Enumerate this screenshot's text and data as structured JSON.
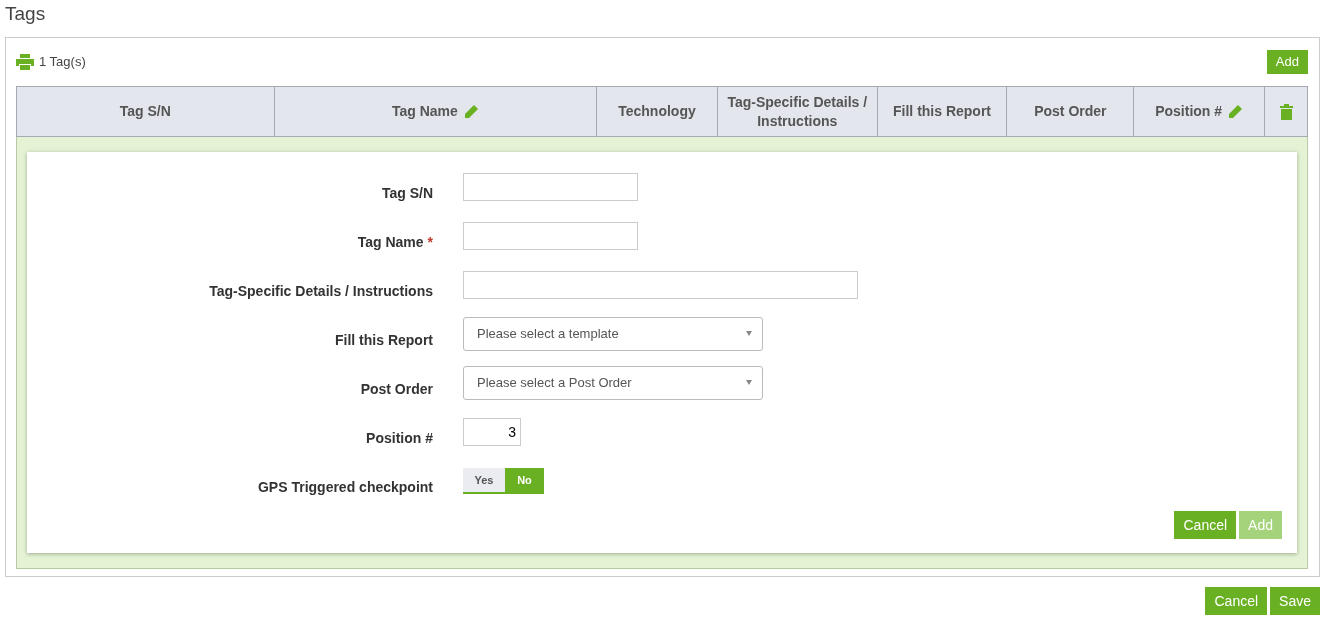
{
  "page_title": "Tags",
  "toolbar": {
    "count": "1 Tag(s)",
    "add_button": "Add"
  },
  "table": {
    "columns": [
      {
        "label": "Tag S/N",
        "editable": false,
        "kind": "text"
      },
      {
        "label": "Tag Name",
        "editable": true,
        "kind": "text"
      },
      {
        "label": "Technology",
        "editable": false,
        "kind": "text"
      },
      {
        "label": "Tag-Specific Details / Instructions",
        "editable": false,
        "kind": "text"
      },
      {
        "label": "Fill this Report",
        "editable": false,
        "kind": "text"
      },
      {
        "label": "Post Order",
        "editable": false,
        "kind": "text"
      },
      {
        "label": "Position #",
        "editable": true,
        "kind": "text"
      },
      {
        "kind": "delete"
      }
    ]
  },
  "form": {
    "fields": [
      {
        "kind": "text",
        "label": "Tag S/N"
      },
      {
        "kind": "text",
        "label": "Tag Name",
        "required_mark": "*"
      },
      {
        "kind": "wide_text",
        "label": "Tag-Specific Details / Instructions"
      },
      {
        "kind": "select",
        "label": "Fill this Report",
        "placeholder": "Please select a template"
      },
      {
        "kind": "select",
        "label": "Post Order",
        "placeholder": "Please select a Post Order"
      },
      {
        "kind": "number",
        "label": "Position #",
        "value": "3"
      },
      {
        "kind": "toggle",
        "label": "GPS Triggered checkpoint",
        "options": [
          {
            "label": "Yes",
            "selected": false
          },
          {
            "label": "No",
            "selected": true
          }
        ]
      }
    ],
    "buttons": [
      {
        "label": "Cancel",
        "disabled": false
      },
      {
        "label": "Add",
        "disabled": true
      }
    ]
  },
  "footer_buttons": [
    {
      "label": "Cancel",
      "disabled": false
    },
    {
      "label": "Save",
      "disabled": false
    }
  ]
}
